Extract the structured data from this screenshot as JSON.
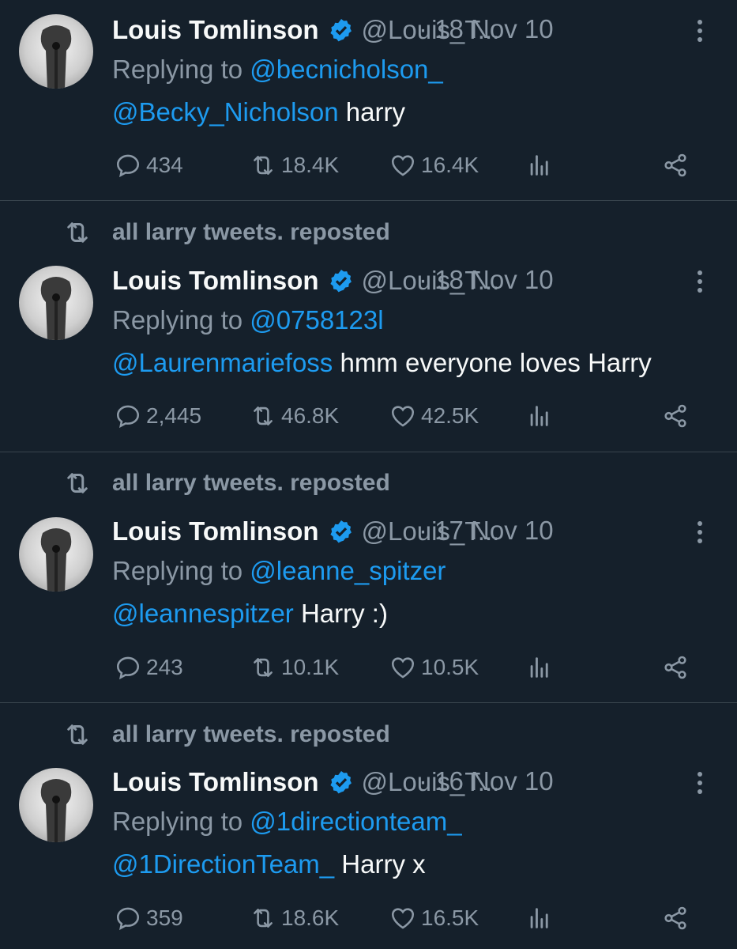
{
  "tweets": [
    {
      "repost_label": "",
      "name": "Louis Tomlinson",
      "handle": "@Louis_T...",
      "date": "· 18 Nov 10",
      "reply_prefix": "Replying to ",
      "reply_to": "@becnicholson_",
      "mention": "@Becky_Nicholson",
      "text": " harry",
      "replies": "434",
      "reposts": "18.4K",
      "likes": "16.4K"
    },
    {
      "repost_label": "all larry tweets. reposted",
      "name": "Louis Tomlinson",
      "handle": "@Louis_T...",
      "date": "· 18 Nov 10",
      "reply_prefix": "Replying to ",
      "reply_to": "@0758123l",
      "mention": "@Laurenmariefoss",
      "text": " hmm everyone loves Harry",
      "replies": "2,445",
      "reposts": "46.8K",
      "likes": "42.5K"
    },
    {
      "repost_label": "all larry tweets. reposted",
      "name": "Louis Tomlinson",
      "handle": "@Louis_T...",
      "date": "· 17 Nov 10",
      "reply_prefix": "Replying to ",
      "reply_to": "@leanne_spitzer",
      "mention": "@leannespitzer",
      "text": " Harry :)",
      "replies": "243",
      "reposts": "10.1K",
      "likes": "10.5K"
    },
    {
      "repost_label": "all larry tweets. reposted",
      "name": "Louis Tomlinson",
      "handle": "@Louis_T...",
      "date": "· 16 Nov 10",
      "reply_prefix": "Replying to ",
      "reply_to": "@1directionteam_",
      "mention": "@1DirectionTeam_",
      "text": " Harry x",
      "replies": "359",
      "reposts": "18.6K",
      "likes": "16.5K"
    }
  ],
  "colors": {
    "background": "#15202b",
    "link": "#1d9bf0",
    "muted": "#8b98a5",
    "text": "#f7f9f9",
    "divider": "#38444d"
  },
  "icons": {
    "repost": "repost-icon",
    "verified": "verified-badge-icon",
    "more": "more-options-icon",
    "reply": "reply-icon",
    "like": "heart-icon",
    "views": "views-icon",
    "share": "share-icon"
  }
}
